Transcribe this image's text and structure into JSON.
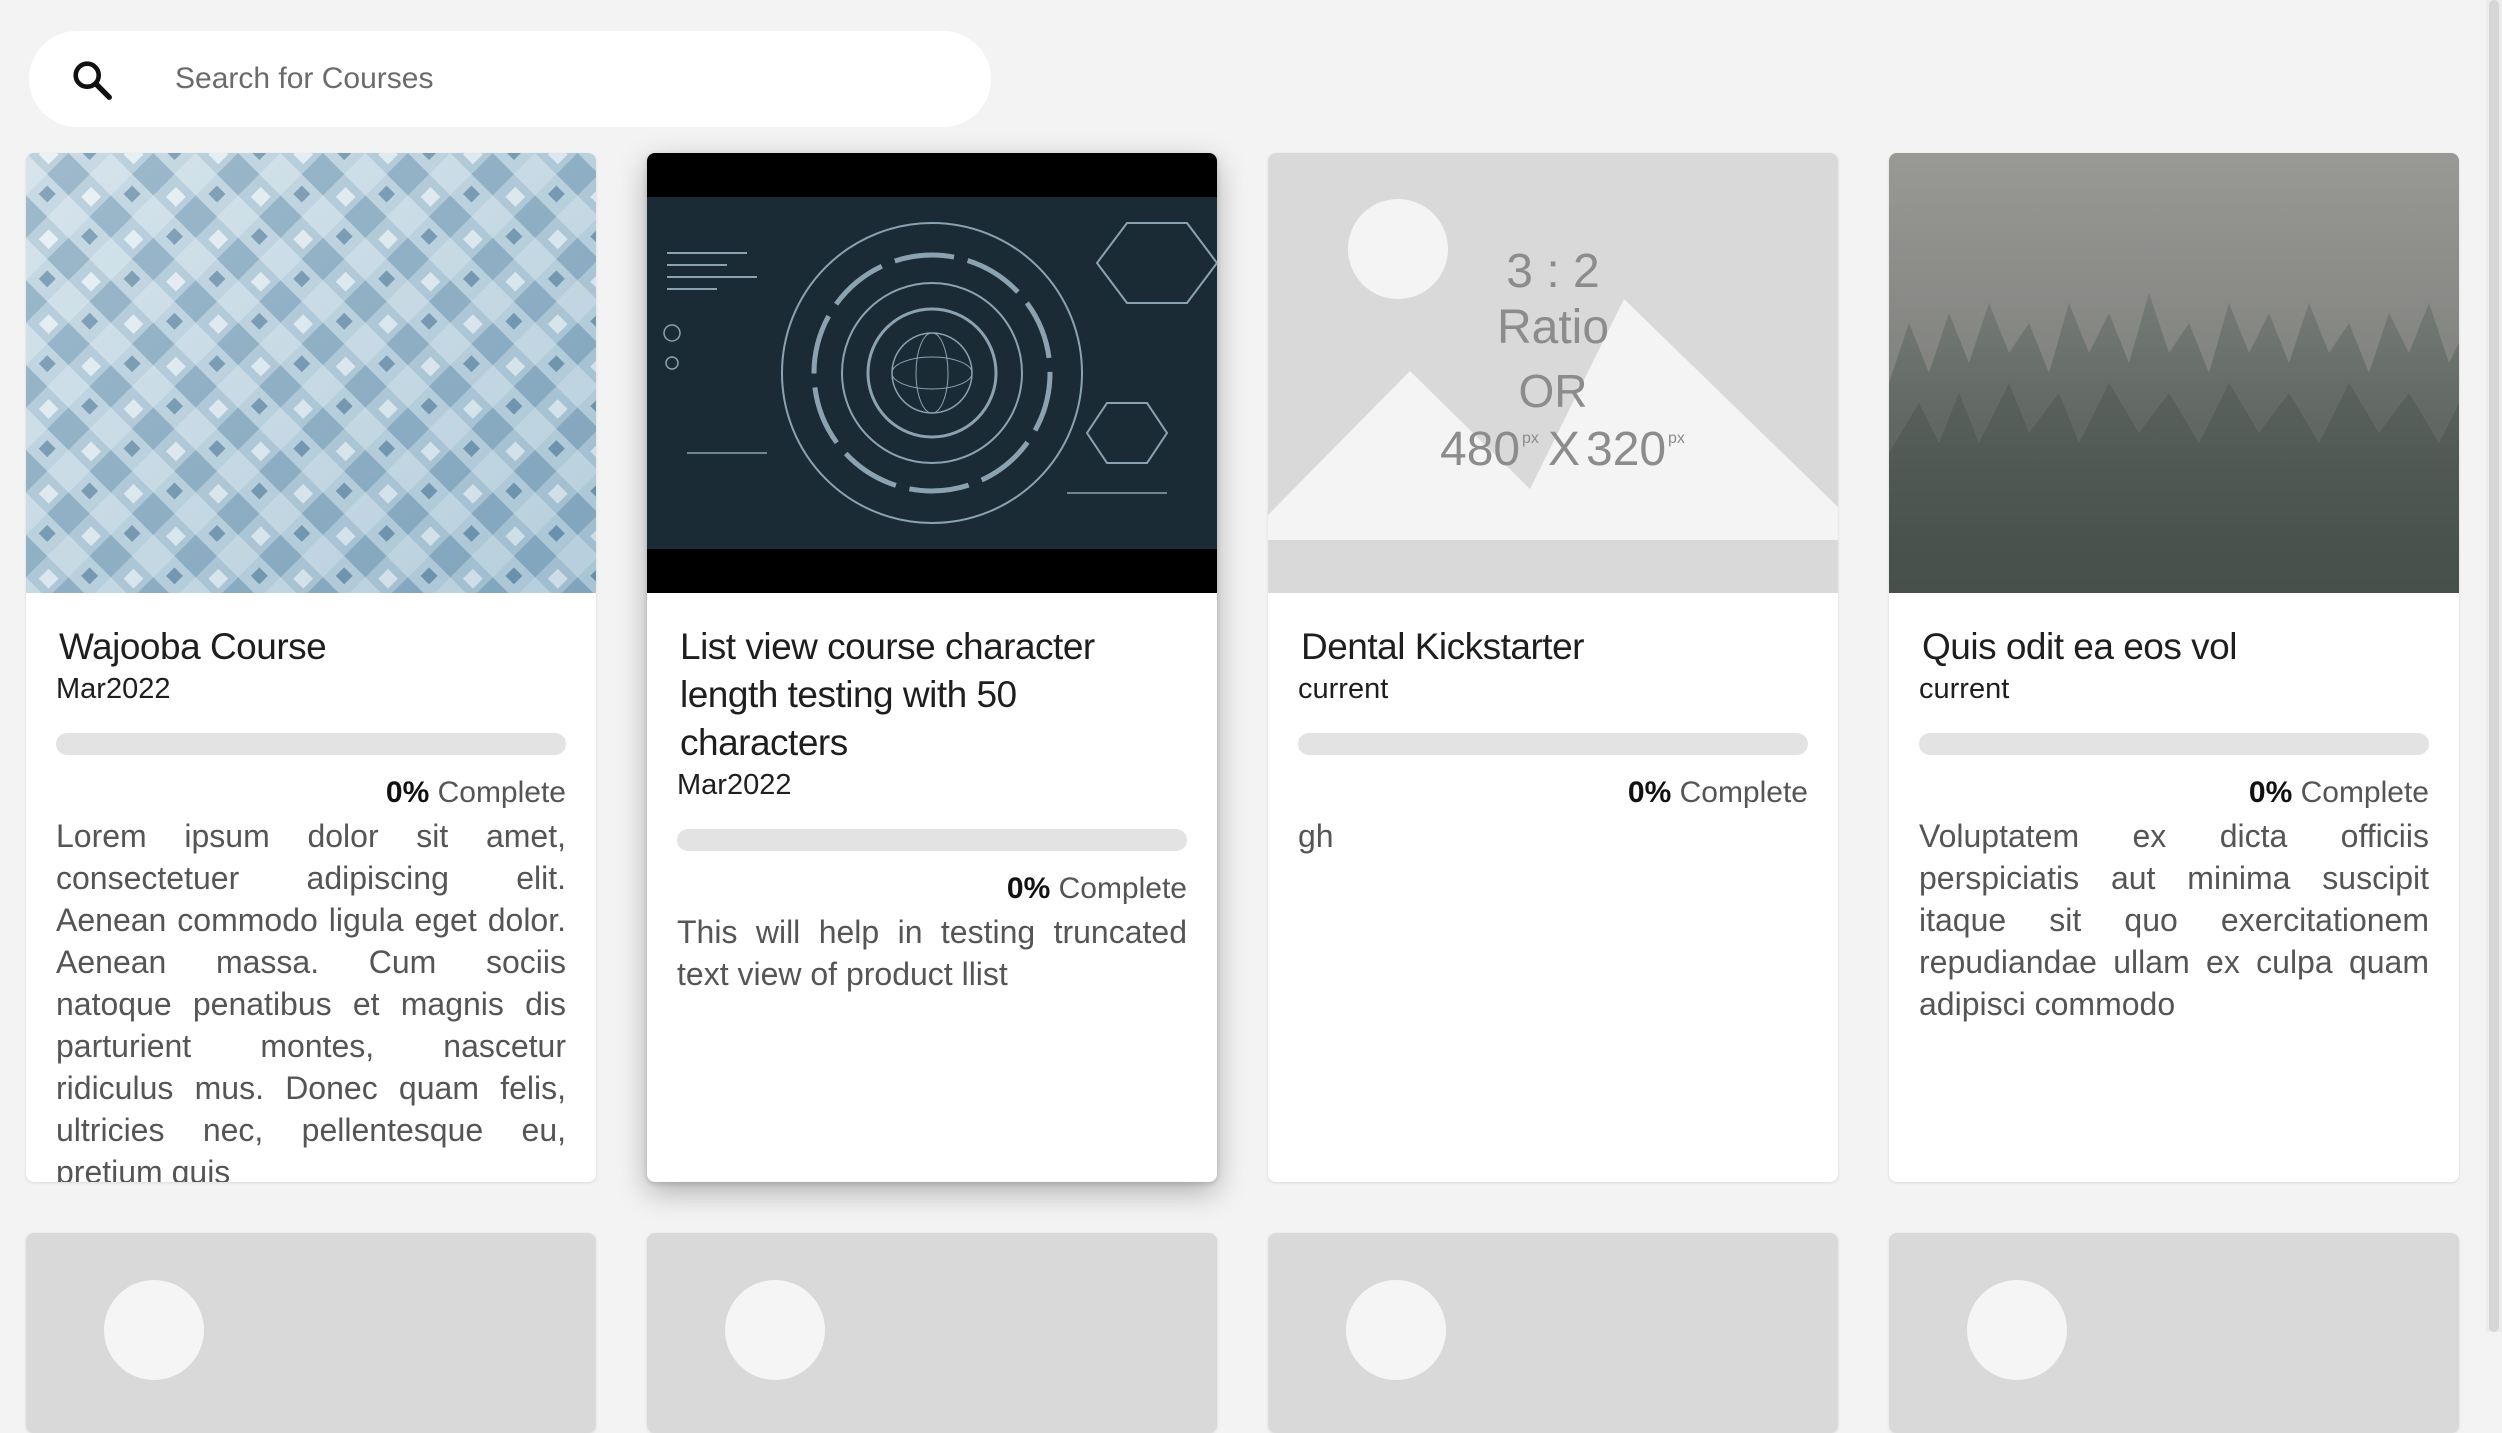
{
  "search": {
    "placeholder": "Search for Courses",
    "icon": "search-icon"
  },
  "courses": [
    {
      "title": "Wajooba Course",
      "date": "Mar2022",
      "progress_percent": 0,
      "progress_value": "0%",
      "progress_suffix": "Complete",
      "description": "Lorem ipsum dolor sit amet, consectetuer adipiscing elit. Aenean commodo ligula eget dolor. Aenean massa. Cum sociis natoque penatibus et magnis dis parturient montes, nascetur ridiculus mus. Donec quam felis, ultricies nec, pellentesque eu, pretium quis",
      "image": "abstract-blue-squares"
    },
    {
      "title": "List view course character length testing with 50 characters",
      "date": "Mar2022",
      "progress_percent": 0,
      "progress_value": "0%",
      "progress_suffix": "Complete",
      "description": "This will help in testing truncated text view of product llist",
      "image": "tech-hud-globe"
    },
    {
      "title": "Dental Kickstarter",
      "date": "current",
      "progress_percent": 0,
      "progress_value": "0%",
      "progress_suffix": "Complete",
      "description": "gh",
      "image": "placeholder",
      "placeholder": {
        "ratio": "3 : 2",
        "ratio_word": "Ratio",
        "or": "OR",
        "width": "480",
        "height": "320",
        "times": "X",
        "unit": "px"
      }
    },
    {
      "title": "Quis odit ea eos vol",
      "date": "current",
      "progress_percent": 0,
      "progress_value": "0%",
      "progress_suffix": "Complete",
      "description": "Voluptatem ex dicta officiis perspiciatis aut minima suscipit itaque sit quo exercitationem repudiandae ullam ex culpa quam adipisci commodo",
      "image": "foggy-forest"
    }
  ],
  "colors": {
    "background": "#f3f3f3",
    "card": "#ffffff",
    "progress_track": "#e3e3e3",
    "placeholder_bg": "#d9d9d9"
  }
}
